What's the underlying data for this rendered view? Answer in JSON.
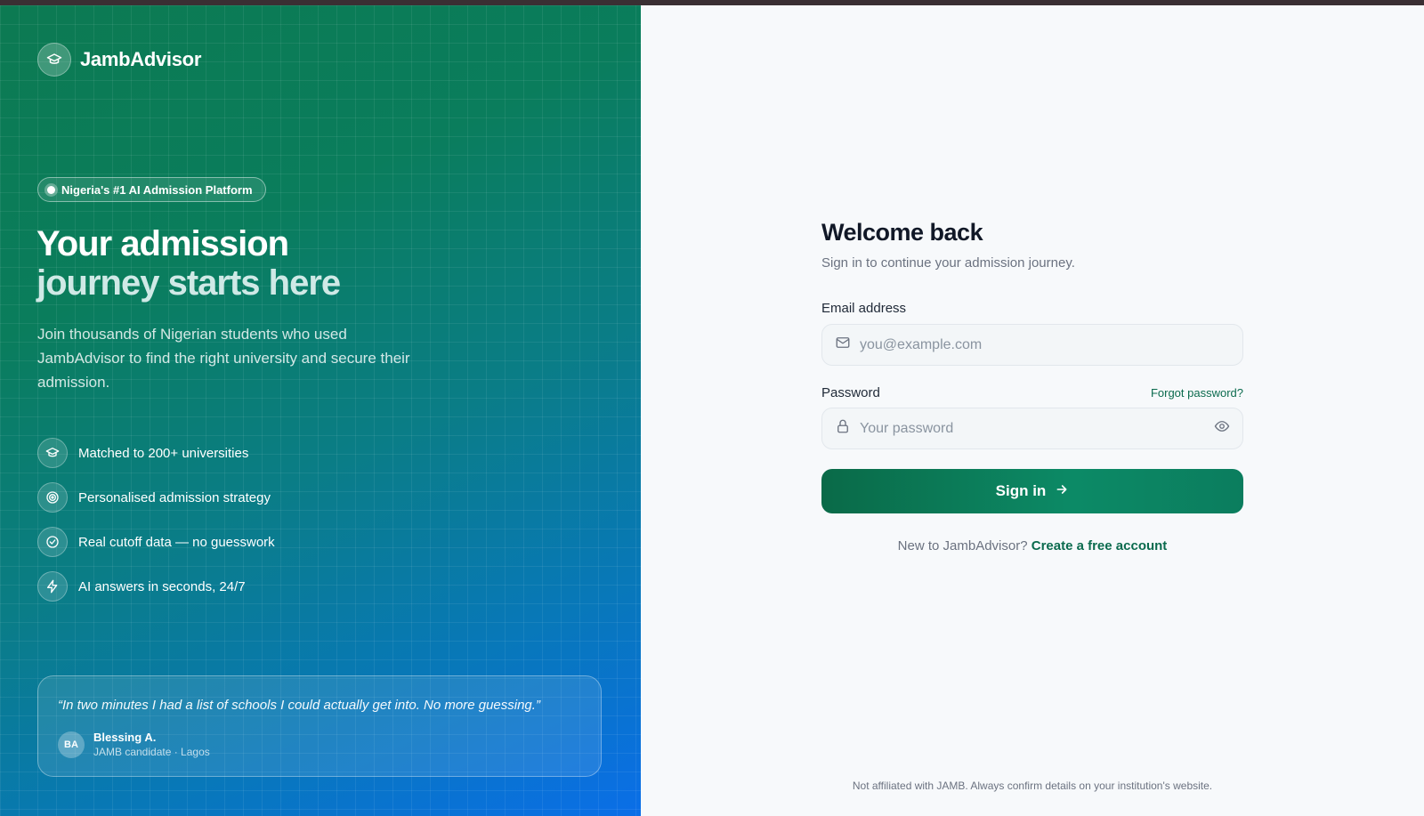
{
  "brand": {
    "name": "JambAdvisor",
    "logo_icon": "graduation-cap-icon"
  },
  "hero": {
    "pill": "Nigeria's #1 AI Admission Platform",
    "title_line1": "Your admission",
    "title_line2": "journey starts here",
    "subtitle": "Join thousands of Nigerian students who used JambAdvisor to find the right university and secure their admission."
  },
  "features": [
    {
      "icon": "graduation-cap-icon",
      "label": "Matched to 200+ universities"
    },
    {
      "icon": "target-icon",
      "label": "Personalised admission strategy"
    },
    {
      "icon": "check-circle-icon",
      "label": "Real cutoff data — no guesswork"
    },
    {
      "icon": "lightning-icon",
      "label": "AI answers in seconds, 24/7"
    }
  ],
  "testimonial": {
    "quote": "“In two minutes I had a list of schools I could actually get into. No more guessing.”",
    "avatar_initials": "BA",
    "author": "Blessing A.",
    "meta": "JAMB candidate · Lagos"
  },
  "form": {
    "title": "Welcome back",
    "subtitle": "Sign in to continue your admission journey.",
    "email_label": "Email address",
    "email_placeholder": "you@example.com",
    "email_value": "",
    "password_label": "Password",
    "forgot_label": "Forgot password?",
    "password_placeholder": "Your password",
    "password_value": "",
    "submit_label": "Sign in",
    "signup_prompt": "New to JambAdvisor?",
    "signup_link": "Create a free account"
  },
  "footer": {
    "disclaimer": "Not affiliated with JAMB. Always confirm details on your institution's website."
  },
  "colors": {
    "accent": "#0b6b4e",
    "panel_start": "#0c7a52",
    "panel_end": "#0a6ee8"
  }
}
